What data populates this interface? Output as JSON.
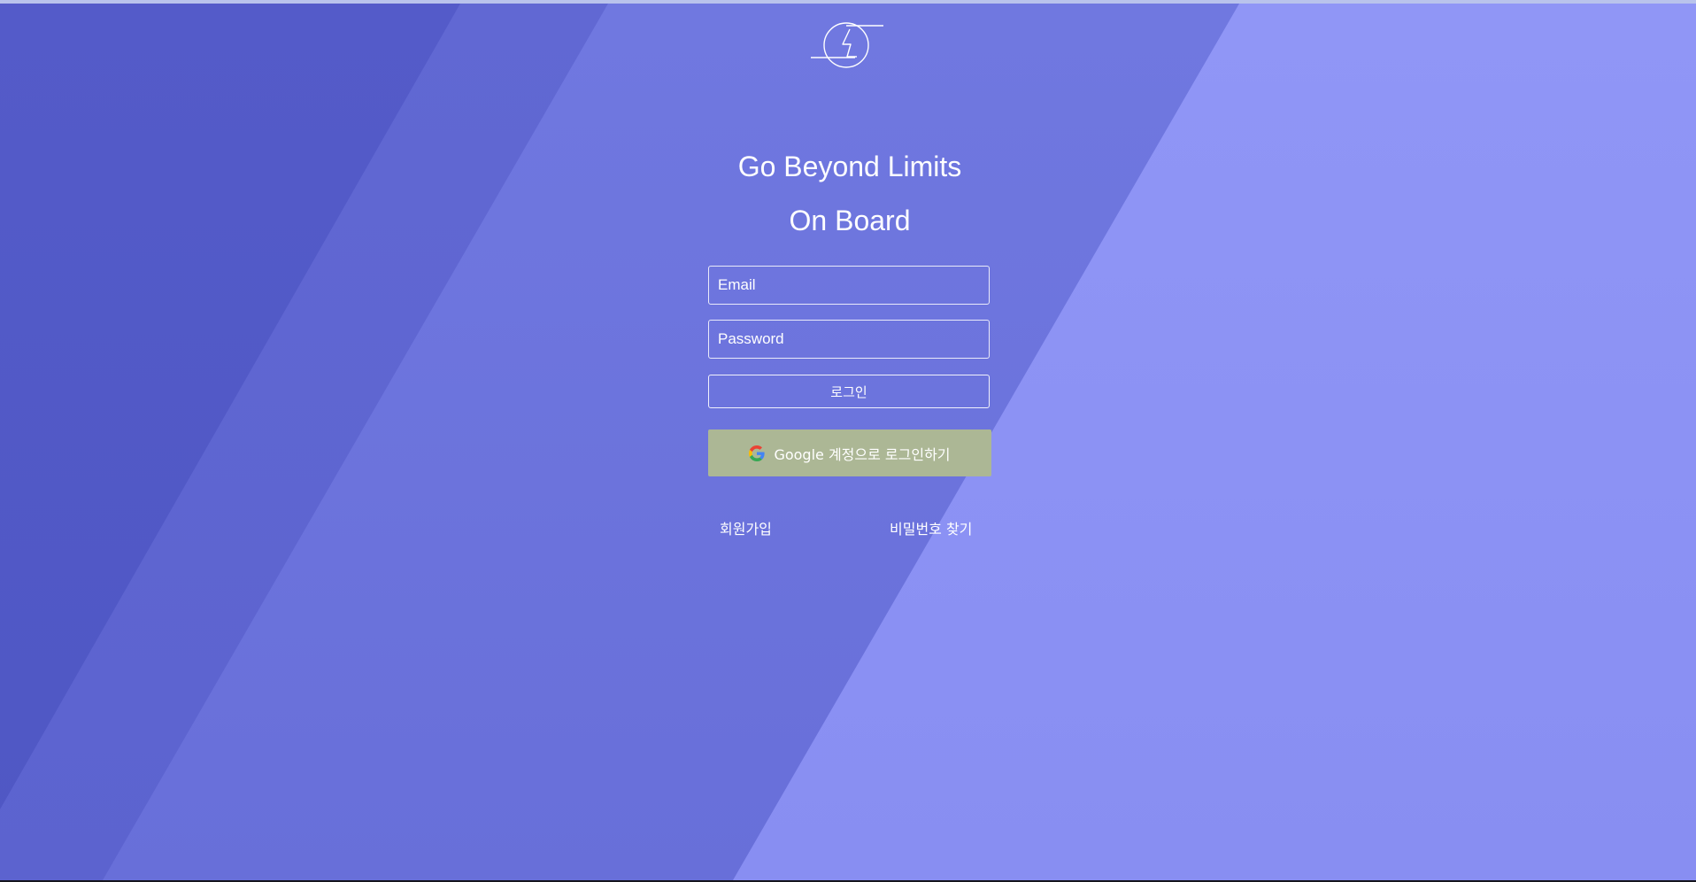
{
  "headline": {
    "line1": "Go Beyond Limits",
    "line2": "On Board"
  },
  "form": {
    "email_placeholder": "Email",
    "email_value": "",
    "password_placeholder": "Password",
    "password_value": "",
    "login_label": "로그인",
    "google_label": "Google 계정으로 로그인하기"
  },
  "links": {
    "signup": "회원가입",
    "find_password": "비밀번호 찾기"
  },
  "icons": {
    "logo": "circle-slash-logo-icon",
    "google": "google-g-icon"
  },
  "colors": {
    "band_dark": "#5159c6",
    "band_mid": "#5f66d2",
    "band_main": "#6c74dd",
    "band_light": "#8b91f4",
    "google_button": "#acb795",
    "text": "#ffffff"
  }
}
